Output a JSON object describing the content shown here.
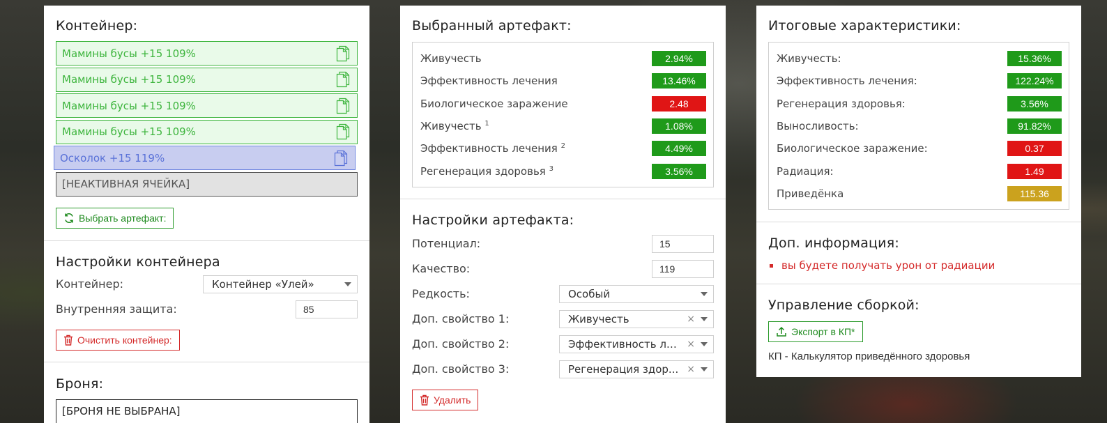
{
  "container_panel": {
    "title": "Контейнер:",
    "slots": [
      {
        "label": "Мамины бусы +15 109%",
        "state": "filled"
      },
      {
        "label": "Мамины бусы +15 109%",
        "state": "filled"
      },
      {
        "label": "Мамины бусы +15 109%",
        "state": "filled"
      },
      {
        "label": "Мамины бусы +15 109%",
        "state": "filled"
      },
      {
        "label": "Осколок +15 119%",
        "state": "selected"
      },
      {
        "label": "[НЕАКТИВНАЯ ЯЧЕЙКА]",
        "state": "inactive"
      }
    ],
    "choose_button": "Выбрать артефакт:",
    "settings_title": "Настройки контейнера",
    "container_label": "Контейнер:",
    "container_value": "Контейнер «Улей»",
    "protection_label": "Внутренняя защита:",
    "protection_value": "85",
    "clear_button": "Очистить контейнер:",
    "armor_title": "Броня:",
    "armor_slot": "[БРОНЯ НЕ ВЫБРАНА]"
  },
  "artifact_panel": {
    "title": "Выбранный артефакт:",
    "stats": [
      {
        "name": "Живучесть",
        "sup": "",
        "value": "2.94%",
        "color": "green"
      },
      {
        "name": "Эффективность лечения",
        "sup": "",
        "value": "13.46%",
        "color": "green"
      },
      {
        "name": "Биологическое заражение",
        "sup": "",
        "value": "2.48",
        "color": "red"
      },
      {
        "name": "Живучесть",
        "sup": "1",
        "value": "1.08%",
        "color": "green"
      },
      {
        "name": "Эффективность лечения",
        "sup": "2",
        "value": "4.49%",
        "color": "green"
      },
      {
        "name": "Регенерация здоровья",
        "sup": "3",
        "value": "3.56%",
        "color": "green"
      }
    ],
    "settings_title": "Настройки артефакта:",
    "potential_label": "Потенциал:",
    "potential_value": "15",
    "quality_label": "Качество:",
    "quality_value": "119",
    "rarity_label": "Редкость:",
    "rarity_value": "Особый",
    "prop1_label": "Доп. свойство 1:",
    "prop1_value": "Живучесть",
    "prop2_label": "Доп. свойство 2:",
    "prop2_value": "Эффективность ле...",
    "prop3_label": "Доп. свойство 3:",
    "prop3_value": "Регенерация здор...",
    "delete_button": "Удалить"
  },
  "totals_panel": {
    "title": "Итоговые характеристики:",
    "stats": [
      {
        "name": "Живучесть:",
        "value": "15.36%",
        "color": "green"
      },
      {
        "name": "Эффективность лечения:",
        "value": "122.24%",
        "color": "green"
      },
      {
        "name": "Регенерация здоровья:",
        "value": "3.56%",
        "color": "green"
      },
      {
        "name": "Выносливость:",
        "value": "91.82%",
        "color": "green"
      },
      {
        "name": "Биологическое заражение:",
        "value": "0.37",
        "color": "red"
      },
      {
        "name": "Радиация:",
        "value": "1.49",
        "color": "red"
      },
      {
        "name": "Приведёнка",
        "value": "115.36",
        "color": "gold"
      }
    ],
    "info_title": "Доп. информация:",
    "info_items": [
      "вы будете получать урон от радиации"
    ],
    "build_title": "Управление сборкой:",
    "export_button": "Экспорт в КП*",
    "footnote": "КП - Калькулятор приведённого здоровья"
  },
  "colors": {
    "green": "#1f9a1a",
    "red": "#e01515",
    "gold": "#cba21e",
    "slot_green": "#3cb43c",
    "slot_blue": "#6b82e0"
  }
}
